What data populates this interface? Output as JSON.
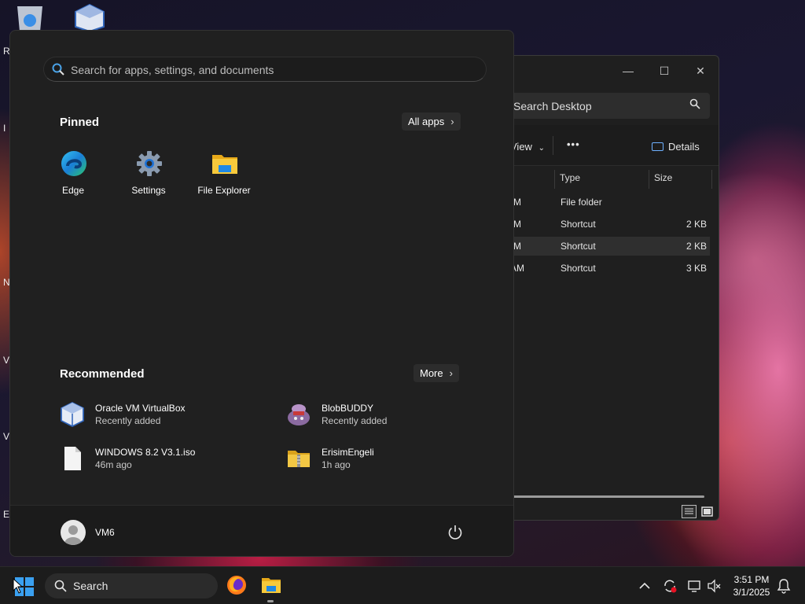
{
  "desktop": {
    "edge_letters": [
      "R",
      "I",
      "N",
      "V",
      "V",
      "E"
    ]
  },
  "explorer": {
    "search_placeholder": "Search Desktop",
    "toolbar": {
      "view_label": "View",
      "more_label": "•••",
      "details_label": "Details"
    },
    "columns": {
      "type": "Type",
      "size": "Size"
    },
    "rows": [
      {
        "date_tail": "M",
        "type": "File folder",
        "size": ""
      },
      {
        "date_tail": "M",
        "type": "Shortcut",
        "size": "2 KB"
      },
      {
        "date_tail": "M",
        "type": "Shortcut",
        "size": "2 KB"
      },
      {
        "date_tail": "AM",
        "type": "Shortcut",
        "size": "3 KB"
      }
    ],
    "controls": {
      "minimize": "—",
      "maximize": "☐",
      "close": "✕"
    }
  },
  "start_menu": {
    "search_placeholder": "Search for apps, settings, and documents",
    "pinned_title": "Pinned",
    "all_apps_label": "All apps",
    "pinned": [
      {
        "label": "Edge",
        "icon": "edge-icon"
      },
      {
        "label": "Settings",
        "icon": "settings-gear-icon"
      },
      {
        "label": "File Explorer",
        "icon": "folder-icon"
      }
    ],
    "recommended_title": "Recommended",
    "more_label": "More",
    "recommended": [
      {
        "name": "Oracle VM VirtualBox",
        "sub": "Recently added",
        "icon": "virtualbox-icon"
      },
      {
        "name": "BlobBUDDY",
        "sub": "Recently added",
        "icon": "blobbuddy-icon"
      },
      {
        "name": "WINDOWS 8.2 V3.1.iso",
        "sub": "46m ago",
        "icon": "file-icon"
      },
      {
        "name": "ErisimEngeli",
        "sub": "1h ago",
        "icon": "zip-folder-icon"
      }
    ],
    "user_name": "VM6"
  },
  "taskbar": {
    "search_label": "Search",
    "time": "3:51 PM",
    "date": "3/1/2025"
  },
  "colors": {
    "accent_blue": "#0a84ff",
    "folder_yellow": "#f5c02c",
    "panel": "#202020"
  }
}
